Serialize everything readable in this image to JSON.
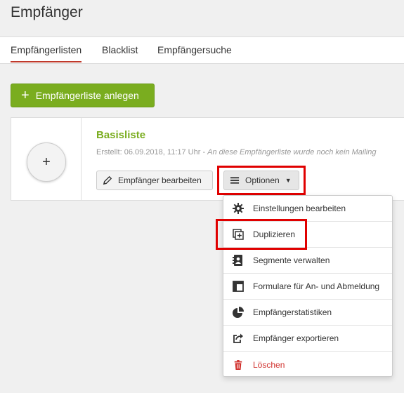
{
  "header": {
    "title": "Empfänger"
  },
  "tabs": [
    {
      "label": "Empfängerlisten",
      "active": true
    },
    {
      "label": "Blacklist",
      "active": false
    },
    {
      "label": "Empfängersuche",
      "active": false
    }
  ],
  "add_button": {
    "label": "Empfängerliste anlegen"
  },
  "card": {
    "add_circle": "+",
    "title": "Basisliste",
    "created": "Erstellt: 06.09.2018, 11:17 Uhr - ",
    "note": "An diese Empfängerliste wurde noch kein Mailing",
    "edit_label": "Empfänger bearbeiten",
    "options_label": "Optionen"
  },
  "menu": {
    "items": [
      {
        "label": "Einstellungen bearbeiten",
        "icon": "gear-icon"
      },
      {
        "label": "Duplizieren",
        "icon": "duplicate-icon"
      },
      {
        "label": "Segmente verwalten",
        "icon": "segment-icon"
      },
      {
        "label": "Formulare für An- und Abmeldung",
        "icon": "form-icon"
      },
      {
        "label": "Empfängerstatistiken",
        "icon": "pie-chart-icon"
      },
      {
        "label": "Empfänger exportieren",
        "icon": "export-icon"
      },
      {
        "label": "Löschen",
        "icon": "trash-icon"
      }
    ]
  },
  "colors": {
    "accent_green": "#7aad1f",
    "danger_red": "#d0312d",
    "highlight_red": "#e00000",
    "tab_underline": "#c0392b"
  }
}
